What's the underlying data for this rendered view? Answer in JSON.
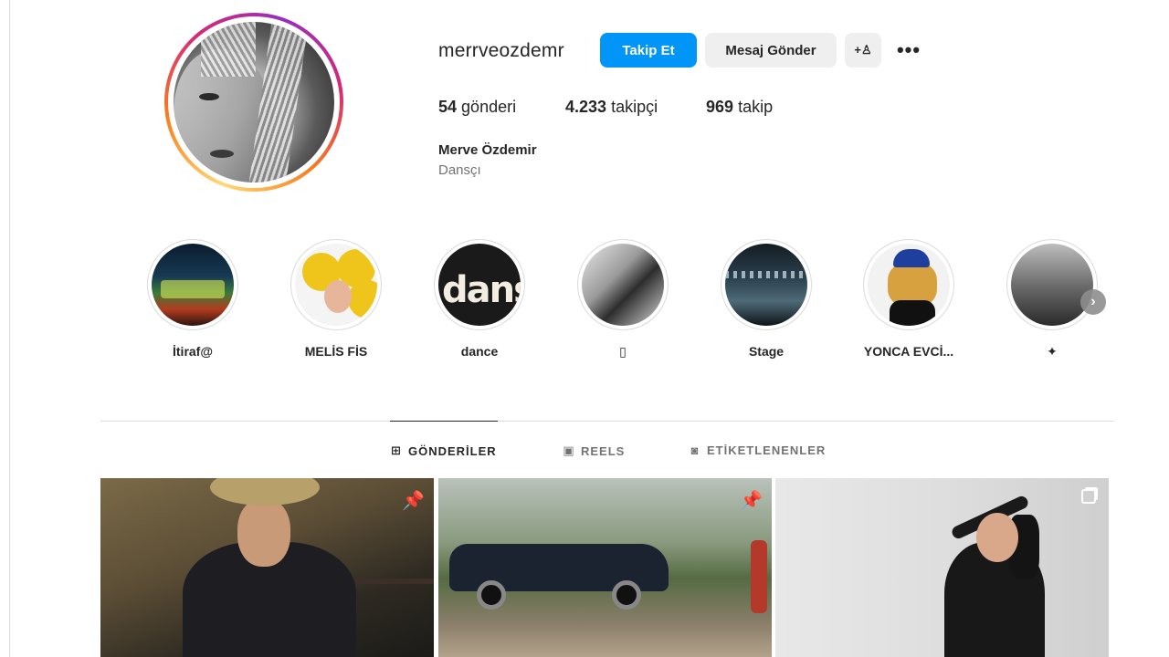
{
  "profile": {
    "username": "merrveozdemr",
    "full_name": "Merve Özdemir",
    "category": "Dansçı",
    "buttons": {
      "follow": "Takip Et",
      "message": "Mesaj Gönder",
      "add_user_icon": "+♙",
      "more": "•••"
    },
    "stats": {
      "posts_count": "54",
      "posts_label": "gönderi",
      "followers_count": "4.233",
      "followers_label": "takipçi",
      "following_count": "969",
      "following_label": "takip"
    }
  },
  "highlights": [
    {
      "label": "İtiraf@"
    },
    {
      "label": "MELİS FİS"
    },
    {
      "label": "dance"
    },
    {
      "label": "▯"
    },
    {
      "label": "Stage"
    },
    {
      "label": "YONCA EVCİ..."
    },
    {
      "label": "✦"
    }
  ],
  "highlight_3_text": "dans",
  "highlight_next_icon": "›",
  "tabs": [
    {
      "label": "GÖNDERİLER",
      "icon": "⊞",
      "active": true
    },
    {
      "label": "REELS",
      "icon": "▣",
      "active": false
    },
    {
      "label": "ETİKETLENENLER",
      "icon": "◙",
      "active": false
    }
  ],
  "posts": [
    {
      "badge": "pin-icon"
    },
    {
      "badge": "pin-icon"
    },
    {
      "badge": "multiple-posts-icon"
    }
  ],
  "pin_glyph": "📌",
  "colors": {
    "primary_button": "#0095f6",
    "secondary_button": "#efefef",
    "divider": "#dbdbdb",
    "muted_text": "#737373"
  }
}
